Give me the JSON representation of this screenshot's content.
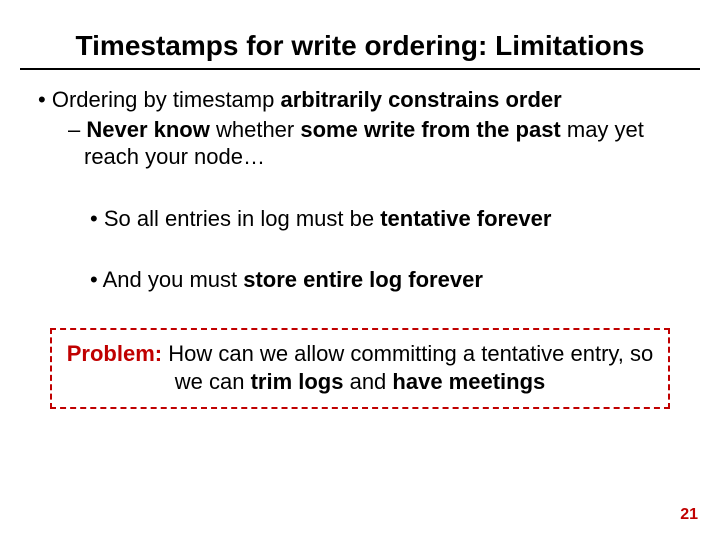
{
  "title": "Timestamps for write ordering: Limitations",
  "bullets": {
    "l1_pre": "Ordering by timestamp ",
    "l1_bold": "arbitrarily constrains order",
    "l2_bold1": "Never know ",
    "l2_mid": "whether ",
    "l2_bold2": "some write from the past ",
    "l2_tail": "may yet reach your node…",
    "l3a_pre": "So all entries in log must be ",
    "l3a_bold": "tentative forever",
    "l3b_pre": "And you must ",
    "l3b_bold": "store entire log forever"
  },
  "problem": {
    "label": "Problem: ",
    "t1": "How can we allow committing a tentative entry, so we can ",
    "b1": "trim logs",
    "t2": " and ",
    "b2": "have meetings"
  },
  "page_number": "21"
}
